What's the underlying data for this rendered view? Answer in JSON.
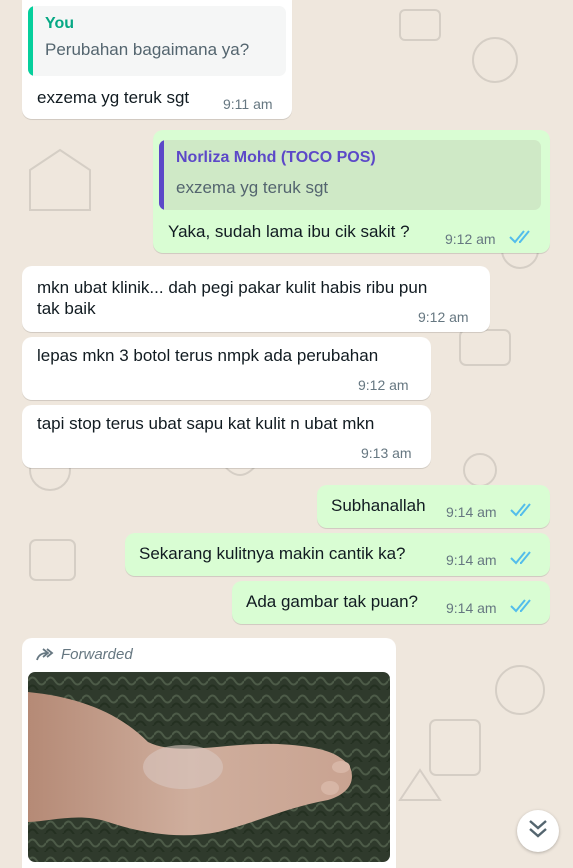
{
  "messages": [
    {
      "quote_name": "You",
      "quote_text": "Perubahan bagaimana ya?",
      "text": "exzema yg teruk sgt",
      "time": "9:11 am"
    },
    {
      "quote_name": "Norliza Mohd (TOCO POS)",
      "quote_text": "exzema yg teruk sgt",
      "text": "Yaka, sudah lama ibu cik sakit ?",
      "time": "9:12 am"
    },
    {
      "text": "mkn ubat klinik... dah pegi pakar kulit habis ribu pun\ntak baik",
      "time": "9:12 am"
    },
    {
      "text": "lepas mkn 3 botol terus nmpk ada perubahan",
      "time": "9:12 am"
    },
    {
      "text": "tapi stop terus ubat sapu kat kulit n ubat mkn",
      "time": "9:13 am"
    },
    {
      "text": "Subhanallah",
      "time": "9:14 am"
    },
    {
      "text": "Sekarang kulitnya makin cantik ka?",
      "time": "9:14 am"
    },
    {
      "text": "Ada gambar tak puan?",
      "time": "9:14 am"
    },
    {
      "forwarded_label": "Forwarded"
    }
  ],
  "colors": {
    "outgoing_bubble": "#d9fdd3",
    "incoming_bubble": "#ffffff",
    "quote_you": "#06cf9c",
    "quote_other": "#5c48c8",
    "read_ticks": "#53bdeb",
    "chat_background": "#efe7dd"
  },
  "icons": {
    "read": "double-check-icon",
    "forwarded": "forward-arrow-icon",
    "scroll": "chevron-double-down-icon"
  }
}
